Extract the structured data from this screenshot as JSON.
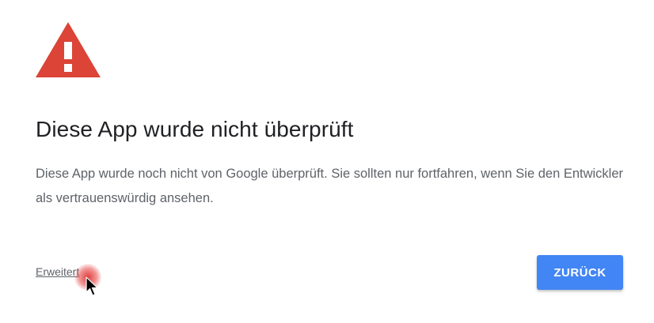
{
  "dialog": {
    "title": "Diese App wurde nicht überprüft",
    "message": "Diese App wurde noch nicht von Google überprüft. Sie sollten nur fortfahren, wenn Sie den Entwickler als vertrauenswürdig ansehen.",
    "advanced_link": "Erweitert",
    "back_button": "ZURÜCK"
  },
  "icons": {
    "warning": "warning-triangle-icon",
    "cursor": "mouse-cursor-icon"
  },
  "colors": {
    "warning_red": "#db4437",
    "button_blue": "#4285f4"
  }
}
